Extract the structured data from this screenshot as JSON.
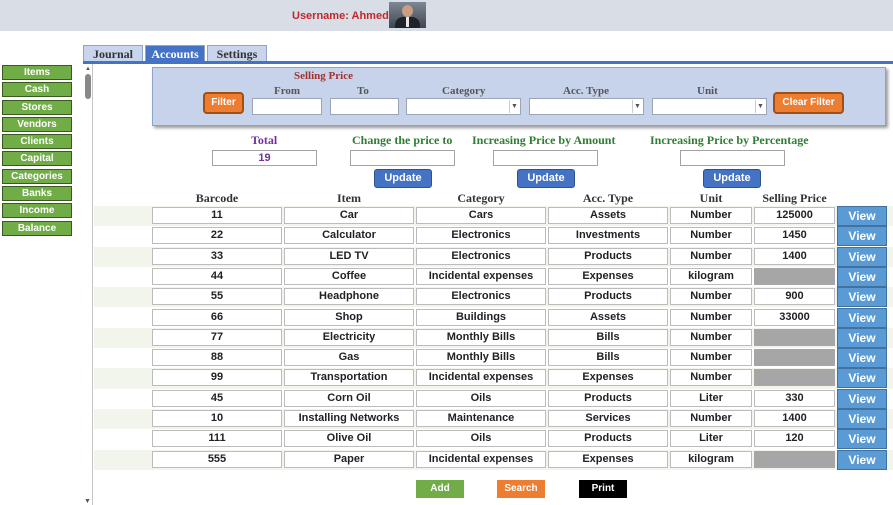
{
  "header": {
    "username_label": "Username: Ahmed"
  },
  "sidebar": {
    "items": [
      {
        "label": "Items"
      },
      {
        "label": "Cash"
      },
      {
        "label": "Stores"
      },
      {
        "label": "Vendors"
      },
      {
        "label": "Clients"
      },
      {
        "label": "Capital"
      },
      {
        "label": "Categories"
      },
      {
        "label": "Banks"
      },
      {
        "label": "Income"
      },
      {
        "label": "Balance"
      }
    ]
  },
  "tabs": [
    {
      "label": "Journal"
    },
    {
      "label": "Accounts"
    },
    {
      "label": "Settings"
    }
  ],
  "active_tab": "Accounts",
  "filter": {
    "selling_price_label": "Selling Price",
    "from_label": "From",
    "to_label": "To",
    "category_label": "Category",
    "acc_type_label": "Acc. Type",
    "unit_label": "Unit",
    "from_value": "",
    "to_value": "",
    "category_value": "",
    "acc_type_value": "",
    "unit_value": "",
    "filter_button": "Filter",
    "clear_button": "Clear Filter"
  },
  "controls": {
    "total_label": "Total",
    "total_value": "19",
    "change_price_label": "Change the price to",
    "increase_amount_label": "Increasing Price by Amount",
    "increase_percent_label": "Increasing Price by Percentage",
    "update_button": "Update"
  },
  "table": {
    "columns": [
      "Barcode",
      "Item",
      "Category",
      "Acc. Type",
      "Unit",
      "Selling Price"
    ],
    "view_label": "View",
    "rows": [
      {
        "barcode": "11",
        "item": "Car",
        "category": "Cars",
        "acc_type": "Assets",
        "unit": "Number",
        "price": "125000"
      },
      {
        "barcode": "22",
        "item": "Calculator",
        "category": "Electronics",
        "acc_type": "Investments",
        "unit": "Number",
        "price": "1450"
      },
      {
        "barcode": "33",
        "item": "LED TV",
        "category": "Electronics",
        "acc_type": "Products",
        "unit": "Number",
        "price": "1400"
      },
      {
        "barcode": "44",
        "item": "Coffee",
        "category": "Incidental expenses",
        "acc_type": "Expenses",
        "unit": "kilogram",
        "price": ""
      },
      {
        "barcode": "55",
        "item": "Headphone",
        "category": "Electronics",
        "acc_type": "Products",
        "unit": "Number",
        "price": "900"
      },
      {
        "barcode": "66",
        "item": "Shop",
        "category": "Buildings",
        "acc_type": "Assets",
        "unit": "Number",
        "price": "33000"
      },
      {
        "barcode": "77",
        "item": "Electricity",
        "category": "Monthly Bills",
        "acc_type": "Bills",
        "unit": "Number",
        "price": ""
      },
      {
        "barcode": "88",
        "item": "Gas",
        "category": "Monthly Bills",
        "acc_type": "Bills",
        "unit": "Number",
        "price": ""
      },
      {
        "barcode": "99",
        "item": "Transportation",
        "category": "Incidental expenses",
        "acc_type": "Expenses",
        "unit": "Number",
        "price": ""
      },
      {
        "barcode": "45",
        "item": "Corn Oil",
        "category": "Oils",
        "acc_type": "Products",
        "unit": "Liter",
        "price": "330"
      },
      {
        "barcode": "10",
        "item": "Installing Networks",
        "category": "Maintenance",
        "acc_type": "Services",
        "unit": "Number",
        "price": "1400"
      },
      {
        "barcode": "111",
        "item": "Olive Oil",
        "category": "Oils",
        "acc_type": "Products",
        "unit": "Liter",
        "price": "120"
      },
      {
        "barcode": "555",
        "item": "Paper",
        "category": "Incidental expenses",
        "acc_type": "Expenses",
        "unit": "kilogram",
        "price": ""
      }
    ]
  },
  "actions": {
    "add": "Add",
    "search": "Search",
    "print": "Print"
  },
  "colors": {
    "sidebar_green": "#70ad47",
    "tab_blue": "#4472c4",
    "filter_orange": "#ed7d31",
    "view_blue": "#5b9bd5",
    "total_purple": "#7030a0",
    "label_green": "#2e7d32"
  }
}
